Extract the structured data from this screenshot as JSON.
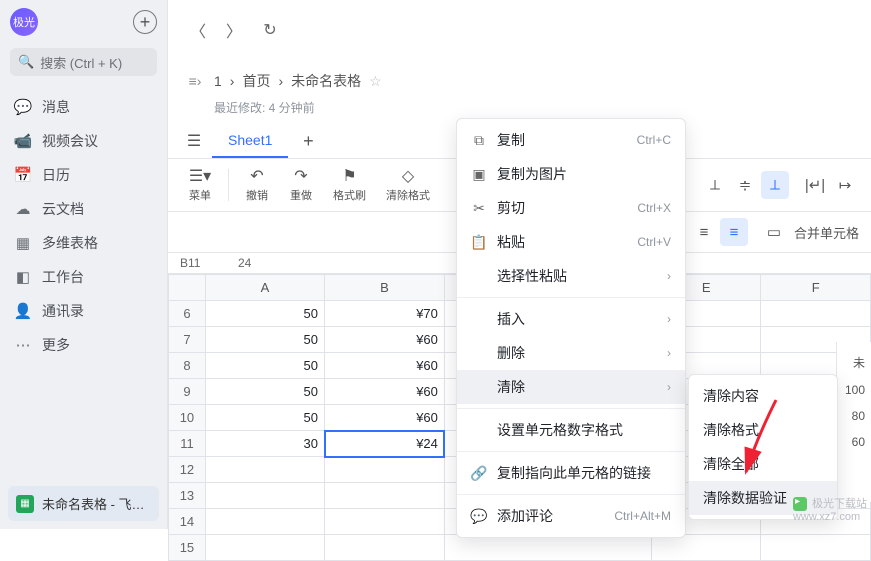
{
  "avatar_text": "极光",
  "search_placeholder": "搜索 (Ctrl + K)",
  "nav": [
    {
      "icon": "💬",
      "label": "消息"
    },
    {
      "icon": "📹",
      "label": "视频会议"
    },
    {
      "icon": "📅",
      "label": "日历"
    },
    {
      "icon": "☁",
      "label": "云文档"
    },
    {
      "icon": "▦",
      "label": "多维表格"
    },
    {
      "icon": "◧",
      "label": "工作台"
    },
    {
      "icon": "👤",
      "label": "通讯录"
    },
    {
      "icon": "⋯",
      "label": "更多"
    }
  ],
  "doc_tab": "未命名表格 - 飞…",
  "crumb": {
    "num": "1",
    "home": "首页",
    "title": "未命名表格"
  },
  "modified": "最近修改: 4 分钟前",
  "sheet_tab": "Sheet1",
  "toolbar": {
    "menu": "菜单",
    "undo": "撤销",
    "redo": "重做",
    "formatpaint": "格式刷",
    "clearfmt": "清除格式",
    "merge": "合并单元格"
  },
  "cellref": {
    "ref": "B11",
    "val": "24"
  },
  "cols": [
    "A",
    "B",
    "",
    "E",
    "F"
  ],
  "rows": [
    {
      "n": "6",
      "a": "50",
      "b": "¥70"
    },
    {
      "n": "7",
      "a": "50",
      "b": "¥60"
    },
    {
      "n": "8",
      "a": "50",
      "b": "¥60"
    },
    {
      "n": "9",
      "a": "50",
      "b": "¥60"
    },
    {
      "n": "10",
      "a": "50",
      "b": "¥60"
    },
    {
      "n": "11",
      "a": "30",
      "b": "¥24"
    },
    {
      "n": "12",
      "a": "",
      "b": ""
    },
    {
      "n": "13",
      "a": "",
      "b": ""
    },
    {
      "n": "14",
      "a": "",
      "b": ""
    },
    {
      "n": "15",
      "a": "",
      "b": ""
    }
  ],
  "menu": {
    "copy": "复制",
    "copy_sc": "Ctrl+C",
    "copyimg": "复制为图片",
    "cut": "剪切",
    "cut_sc": "Ctrl+X",
    "paste": "粘贴",
    "paste_sc": "Ctrl+V",
    "pastespec": "选择性粘贴",
    "insert": "插入",
    "delete": "删除",
    "clear": "清除",
    "numfmt": "设置单元格数字格式",
    "copylink": "复制指向此单元格的链接",
    "comment": "添加评论",
    "comment_sc": "Ctrl+Alt+M"
  },
  "submenu": {
    "content": "清除内容",
    "format": "清除格式",
    "all": "清除全部",
    "validation": "清除数据验证"
  },
  "panel": {
    "t1": "未",
    "t2": "100",
    "t3": "80",
    "t4": "60"
  },
  "watermark": {
    "brand": "极光下载站",
    "url": "www.xz7.com"
  }
}
